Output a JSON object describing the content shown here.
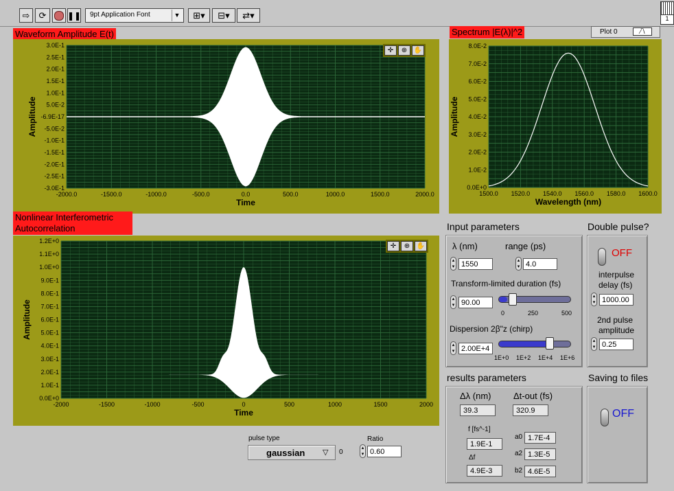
{
  "toolbar": {
    "font_select": "9pt Application Font",
    "run_icon": "run-arrow-icon",
    "run_continuous_icon": "run-continuous-icon",
    "abort_icon": "abort-icon",
    "pause_icon": "pause-icon",
    "align_icon": "align-objects-icon",
    "distribute_icon": "distribute-objects-icon",
    "reorder_icon": "reorder-icon",
    "corner_badge": "1"
  },
  "waveform": {
    "label": "Waveform Amplitude E(t)",
    "ylabel": "Amplitude",
    "xlabel": "Time",
    "yticks": [
      "3.0E-1",
      "2.5E-1",
      "2.0E-1",
      "1.5E-1",
      "1.0E-1",
      "5.0E-2",
      "-6.9E-17",
      "-5.0E-2",
      "-1.0E-1",
      "-1.5E-1",
      "-2.0E-1",
      "-2.5E-1",
      "-3.0E-1"
    ],
    "xticks": [
      "-2000.0",
      "-1500.0",
      "-1000.0",
      "-500.0",
      "0.0",
      "500.0",
      "1000.0",
      "1500.0",
      "2000.0"
    ]
  },
  "spectrum": {
    "label": "Spectrum |E(λ)|^2",
    "legend_label": "Plot 0",
    "ylabel": "Amplitude",
    "xlabel": "Wavelength (nm)",
    "yticks": [
      "8.0E-2",
      "7.0E-2",
      "6.0E-2",
      "5.0E-2",
      "4.0E-2",
      "3.0E-2",
      "2.0E-2",
      "1.0E-2",
      "0.0E+0"
    ],
    "xticks": [
      "1500.0",
      "1520.0",
      "1540.0",
      "1560.0",
      "1580.0",
      "1600.0"
    ]
  },
  "autocorr": {
    "label_line1": "Nonlinear Interferometric",
    "label_line2": "Autocorrelation",
    "ylabel": "Amplitude",
    "xlabel": "Time",
    "yticks": [
      "1.2E+0",
      "1.1E+0",
      "1.0E+0",
      "9.0E-1",
      "8.0E-1",
      "7.0E-1",
      "6.0E-1",
      "5.0E-1",
      "4.0E-1",
      "3.0E-1",
      "2.0E-1",
      "1.0E-1",
      "0.0E+0"
    ],
    "xticks": [
      "-2000",
      "-1500",
      "-1000",
      "-500",
      "0",
      "500",
      "1000",
      "1500",
      "2000"
    ]
  },
  "chart_data": [
    {
      "type": "line",
      "title": "Waveform Amplitude E(t)",
      "xlabel": "Time",
      "ylabel": "Amplitude",
      "xlim": [
        -2000,
        2000
      ],
      "ylim": [
        -0.3,
        0.3
      ],
      "grid": true,
      "description_values": {
        "envelope_peak": 0.29,
        "center": 0,
        "fwhm_approx": 400
      }
    },
    {
      "type": "line",
      "title": "Spectrum |E(λ)|^2",
      "xlabel": "Wavelength (nm)",
      "ylabel": "Amplitude",
      "xlim": [
        1500,
        1600
      ],
      "ylim": [
        0,
        0.08
      ],
      "grid": true,
      "x": [
        1500,
        1510,
        1520,
        1530,
        1540,
        1545,
        1550,
        1555,
        1560,
        1570,
        1580,
        1590,
        1600
      ],
      "y": [
        0.0005,
        0.004,
        0.016,
        0.042,
        0.068,
        0.074,
        0.076,
        0.074,
        0.068,
        0.042,
        0.016,
        0.004,
        0.0005
      ]
    },
    {
      "type": "line",
      "title": "Nonlinear Interferometric Autocorrelation",
      "xlabel": "Time",
      "ylabel": "Amplitude",
      "xlim": [
        -2000,
        2000
      ],
      "ylim": [
        0,
        1.2
      ],
      "grid": true,
      "description_values": {
        "baseline": 0.18,
        "peak": 1.0
      }
    }
  ],
  "input_params": {
    "title": "Input parameters",
    "lambda_label": "λ (nm)",
    "lambda_value": "1550",
    "range_label": "range (ps)",
    "range_value": "4.0",
    "tl_label": "Transform-limited duration (fs)",
    "tl_value": "90.00",
    "tl_slider_fraction": 0.1,
    "tl_ticks": [
      "0",
      "250",
      "500"
    ],
    "disp_label": "Dispersion 2β\"z (chirp)",
    "disp_value": "2.00E+4",
    "disp_slider_fraction": 0.72,
    "disp_ticks": [
      "1E+0",
      "1E+2",
      "1E+4",
      "1E+6"
    ]
  },
  "double_pulse": {
    "title": "Double pulse?",
    "state": "OFF",
    "delay_label_1": "interpulse",
    "delay_label_2": "delay (fs)",
    "delay_value": "1000.00",
    "amp_label_1": "2nd pulse",
    "amp_label_2": "amplitude",
    "amp_value": "0.25"
  },
  "results": {
    "title": "results parameters",
    "dlambda_label": "Δλ (nm)",
    "dlambda_value": "39.3",
    "dtout_label": "Δt-out (fs)",
    "dtout_value": "320.9",
    "f_label": "f [fs^-1]",
    "f_value": "1.9E-1",
    "df_label": "Δf",
    "df_value": "4.9E-3",
    "a0_label": "a0",
    "a0_value": "1.7E-4",
    "a2_label": "a2",
    "a2_value": "1.3E-5",
    "b2_label": "b2",
    "b2_value": "4.6E-5"
  },
  "saving": {
    "title": "Saving to files",
    "state": "OFF"
  },
  "pulse": {
    "type_label": "pulse type",
    "type_value": "gaussian",
    "type_index": "0",
    "ratio_label": "Ratio",
    "ratio_value": "0.60"
  },
  "colors": {
    "plot_bg": "#0b2a12",
    "grid": "#2e6a3a",
    "frame": "#9c9a18",
    "label_bg": "#ff1a1a",
    "off_red": "#e00000",
    "off_blue": "#1818d0"
  }
}
